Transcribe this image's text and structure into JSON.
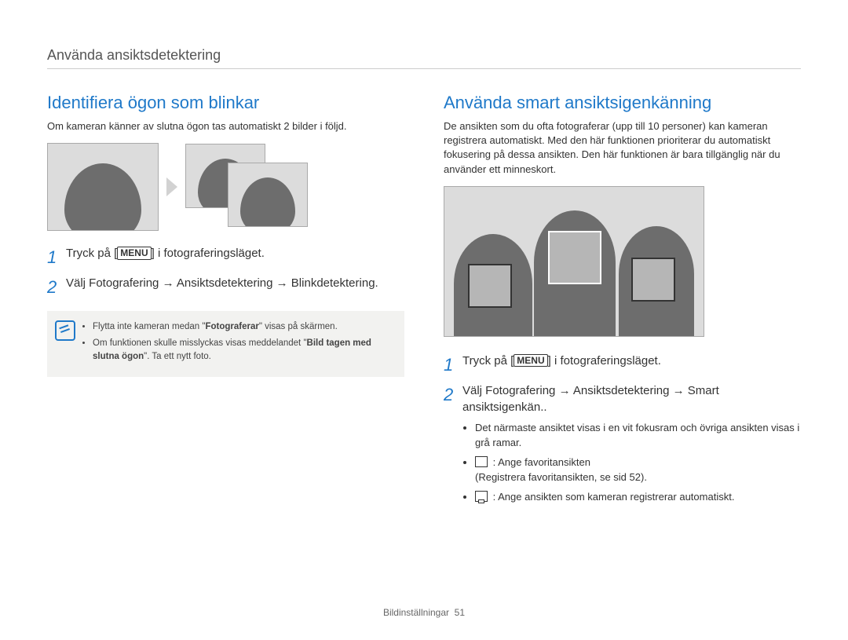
{
  "header": {
    "chapter": "Använda ansiktsdetektering"
  },
  "left": {
    "heading": "Identifiera ögon som blinkar",
    "intro": "Om kameran känner av slutna ögon tas automatiskt 2 bilder i följd.",
    "steps": {
      "s1_num": "1",
      "s1_pre": "Tryck på [",
      "s1_key": "MENU",
      "s1_post": "] i fotograferingsläget.",
      "s2_num": "2",
      "s2_text": "Välj Fotografering → Ansiktsdetektering → Blinkdetektering."
    },
    "notes": {
      "n1_pre": "Flytta inte kameran medan \"",
      "n1_bold": "Fotograferar",
      "n1_post": "\" visas på skärmen.",
      "n2_pre": "Om funktionen skulle misslyckas visas meddelandet \"",
      "n2_bold": "Bild tagen med slutna ögon",
      "n2_post": "\". Ta ett nytt foto."
    }
  },
  "right": {
    "heading": "Använda smart ansiktsigenkänning",
    "intro": "De ansikten som du ofta fotograferar (upp till 10 personer) kan kameran registrera automatiskt. Med den här funktionen prioriterar du automatiskt fokusering på dessa ansikten. Den här funktionen är bara tillgänglig när du använder ett minneskort.",
    "steps": {
      "s1_num": "1",
      "s1_pre": "Tryck på [",
      "s1_key": "MENU",
      "s1_post": "] i fotograferingsläget.",
      "s2_num": "2",
      "s2_text": "Välj Fotografering → Ansiktsdetektering → Smart ansiktsigenkän.."
    },
    "details": {
      "d1": "Det närmaste ansiktet visas i en vit fokusram och övriga ansikten visas i grå ramar.",
      "d2_label": ": Ange favoritansikten",
      "d2_sub": "(Registrera favoritansikten, se sid 52).",
      "d3_label": ": Ange ansikten som kameran registrerar automatiskt."
    }
  },
  "footer": {
    "section": "Bildinställningar",
    "page": "51"
  }
}
